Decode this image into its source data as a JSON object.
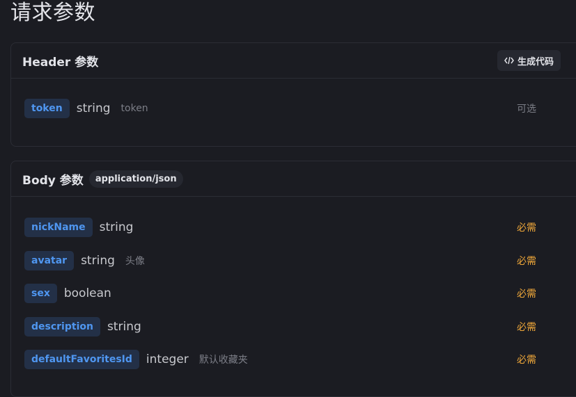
{
  "page_title": "请求参数",
  "header_section": {
    "title": "Header 参数",
    "codegen_label": "生成代码",
    "params": [
      {
        "name": "token",
        "type": "string",
        "desc": "token",
        "req": "可选"
      }
    ]
  },
  "body_section": {
    "title": "Body 参数",
    "content_type": "application/json",
    "params": [
      {
        "name": "nickName",
        "type": "string",
        "desc": "",
        "req": "必需"
      },
      {
        "name": "avatar",
        "type": "string",
        "desc": "头像",
        "req": "必需"
      },
      {
        "name": "sex",
        "type": "boolean",
        "desc": "",
        "req": "必需"
      },
      {
        "name": "description",
        "type": "string",
        "desc": "",
        "req": "必需"
      },
      {
        "name": "defaultFavoritesId",
        "type": "integer",
        "desc": "默认收藏夹",
        "req": "必需"
      }
    ]
  },
  "colors": {
    "background": "#1b1c22",
    "param_name_bg": "#233047",
    "param_name_text": "#4f96f0",
    "required": "#f0a83a"
  }
}
